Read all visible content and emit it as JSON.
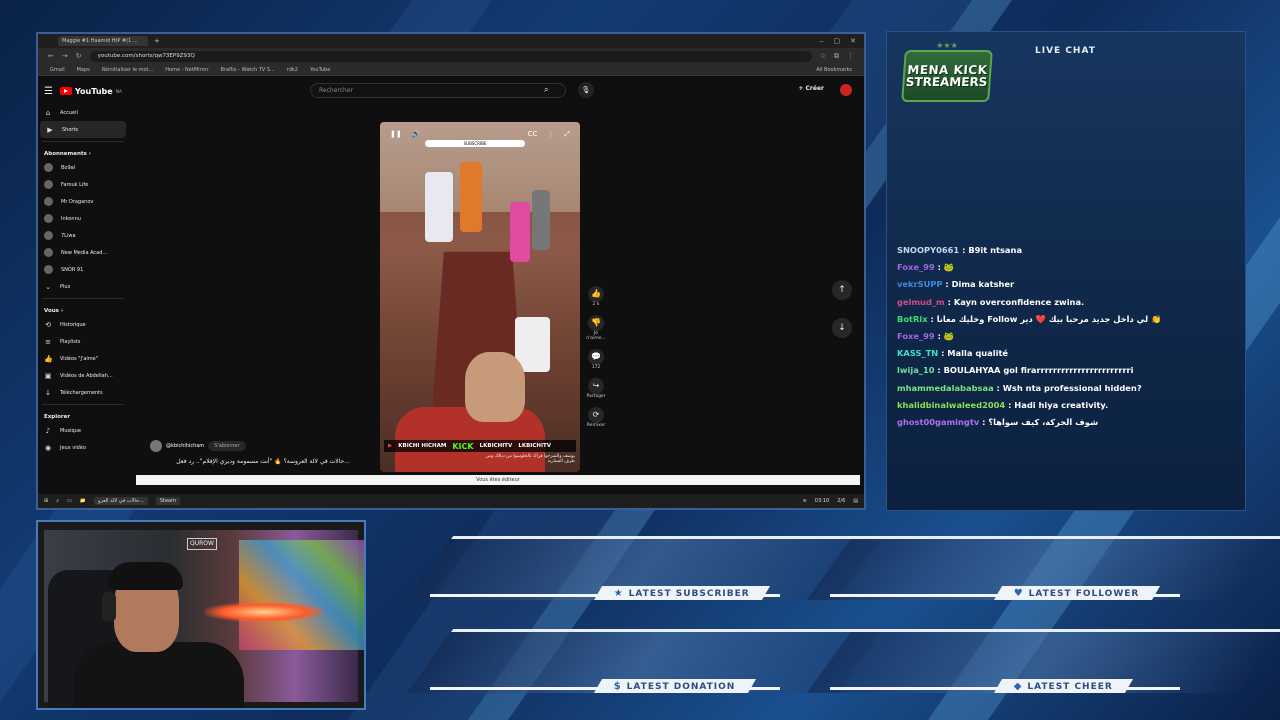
{
  "browser": {
    "tabs": [
      "Maggie #1 Haamid HtP #(1 ...",
      ""
    ],
    "url": "youtube.com/shorts/qw73EP9Z93Q",
    "bookmarks": [
      "Gmail",
      "Maps",
      "Réinitialiser le mot...",
      "Home - NetMirror",
      "Braflix - Watch TV S...",
      "rdk2",
      "YouTube"
    ],
    "all_bookmarks": "All Bookmarks"
  },
  "youtube": {
    "logo": "YouTube",
    "logo_sup": "MA",
    "search_placeholder": "Rechercher",
    "create_label": "Créer",
    "nav": [
      {
        "label": "Accueil",
        "icon": "home-icon"
      },
      {
        "label": "Shorts",
        "icon": "shorts-icon"
      }
    ],
    "subs_header": "Abonnements ›",
    "subscriptions": [
      "Bo9al",
      "Farouk Life",
      "Mr Draganov",
      "Inkonnu",
      "7Liwa",
      "New Media Acad...",
      "SNOR 91"
    ],
    "more": "Plus",
    "you_header": "Vous ›",
    "you_items": [
      {
        "label": "Historique",
        "icon": "history-icon"
      },
      {
        "label": "Playlists",
        "icon": "playlist-icon"
      },
      {
        "label": "Vidéos \"J'aime\"",
        "icon": "like-icon"
      },
      {
        "label": "Vidéos de Abdellah...",
        "icon": "video-icon"
      },
      {
        "label": "Téléchargements",
        "icon": "download-icon"
      }
    ],
    "explore_header": "Explorer",
    "explore_items": [
      {
        "label": "Musique",
        "icon": "music-icon"
      },
      {
        "label": "Jeux vidéo",
        "icon": "game-icon"
      }
    ],
    "short": {
      "subscribe_bar": "SUBSCRIBE",
      "banner_name": "KBICHI HICHAM",
      "banner_kick": "KICK",
      "banner_handle": "LKBICHITV",
      "banner_handle2": "LKBICHITV",
      "caption": "يوسف والشرجوا قراك بالخلوسوا من ديالك ومن طرف الستارية",
      "channel": "@kbichihicham",
      "subscribe_btn": "S'abonner",
      "title": "...حالات في لالة العروسة؟ 🔥 \"أنت مسمومة وديري الإفلام\".. رد فعل"
    },
    "actions": [
      {
        "icon": "thumb-up-icon",
        "label": "2 k"
      },
      {
        "icon": "thumb-down-icon",
        "label": "Je n'aime..."
      },
      {
        "icon": "comment-icon",
        "label": "172"
      },
      {
        "icon": "share-icon",
        "label": "Partager"
      },
      {
        "icon": "remix-icon",
        "label": "Remixer"
      }
    ],
    "editor_bar": "Vous êtes éditeur"
  },
  "taskbar": {
    "apps": [
      "حالات في لالة العرو...",
      "Steam"
    ],
    "time": "03:10",
    "date": "2/6"
  },
  "chat": {
    "logo_line1": "MENA KICK",
    "logo_line2": "STREAMERS",
    "title": "LIVE CHAT",
    "messages": [
      {
        "user": "SNOOPY0661",
        "color": "#c8d6ea",
        "text": "B9it ntsana"
      },
      {
        "user": "Foxe_99",
        "color": "#a066e0",
        "text": "🐸"
      },
      {
        "user": "vekrSUPP",
        "color": "#3d8be0",
        "text": "Dima katsher"
      },
      {
        "user": "gelmud_m",
        "color": "#d04a8a",
        "text": "Kayn overconfidence zwina."
      },
      {
        "user": "BotRix",
        "color": "#3ee06a",
        "text": "وخليك معانا Follow لي داخل جديد مرحبا بيك ❤️ دير 👏"
      },
      {
        "user": "Foxe_99",
        "color": "#a066e0",
        "text": "🐸"
      },
      {
        "user": "KASS_TN",
        "color": "#3ee0c8",
        "text": "Malla qualité"
      },
      {
        "user": "lwija_10",
        "color": "#6ee0a0",
        "text": "BOULAHYAA gol firarrrrrrrrrrrrrrrrrrrrrrri"
      },
      {
        "user": "mhammedalababsaa",
        "color": "#7ee07a",
        "text": "Wsh nta professional hidden?"
      },
      {
        "user": "khalidbinalwaleed2004",
        "color": "#8ae050",
        "text": "Hadi hiya creativity."
      },
      {
        "user": "ghost00gamingtv",
        "color": "#b070f0",
        "text": "شوف الحركة، كيف سواها؟"
      }
    ]
  },
  "webcam": {
    "tag": "QUROW"
  },
  "alerts": [
    {
      "label": "LATEST SUBSCRIBER",
      "icon": "star-icon"
    },
    {
      "label": "LATEST FOLLOWER",
      "icon": "heart-icon"
    },
    {
      "label": "LATEST DONATION",
      "icon": "dollar-icon"
    },
    {
      "label": "LATEST CHEER",
      "icon": "diamond-icon"
    }
  ]
}
